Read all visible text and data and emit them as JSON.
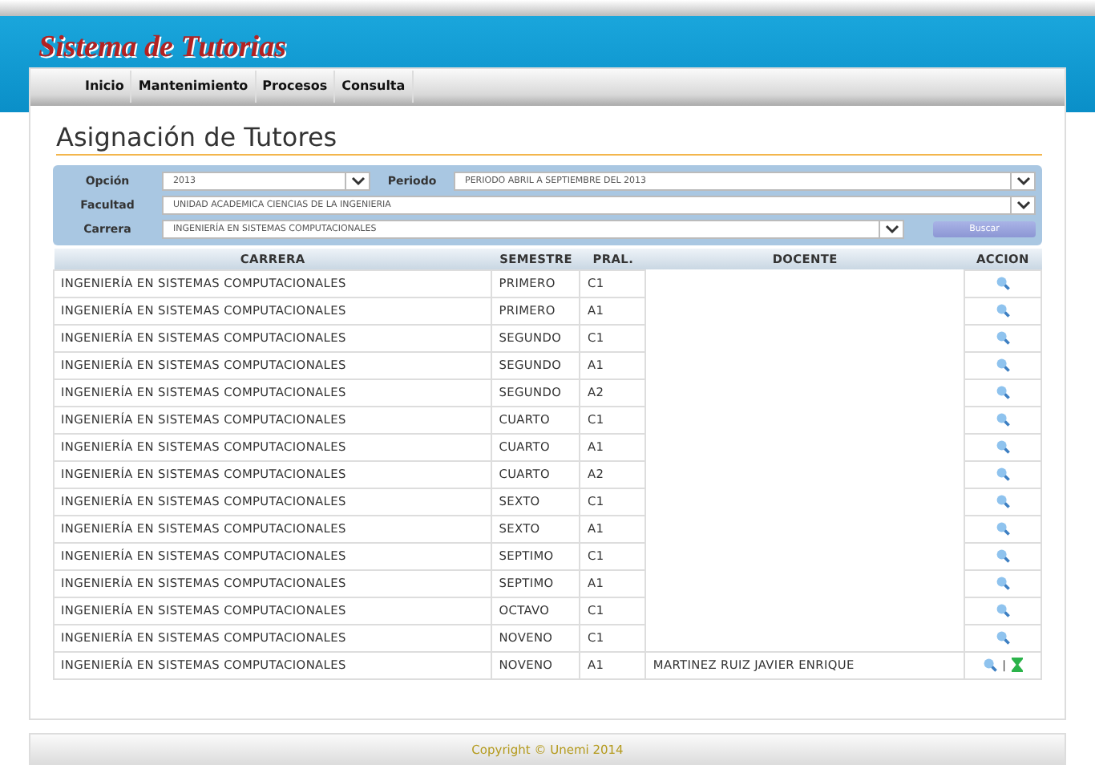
{
  "header": {
    "title": "Sistema de Tutorias"
  },
  "menu": [
    {
      "label": "Inicio"
    },
    {
      "label": "Mantenimiento"
    },
    {
      "label": "Procesos"
    },
    {
      "label": "Consulta"
    }
  ],
  "page_title": "Asignación de Tutores",
  "filters": {
    "opcion": {
      "label": "Opción",
      "value": "2013"
    },
    "periodo": {
      "label": "Periodo",
      "value": "PERIODO ABRIL A SEPTIEMBRE DEL 2013"
    },
    "facultad": {
      "label": "Facultad",
      "value": "UNIDAD ACADEMICA CIENCIAS DE LA INGENIERIA"
    },
    "carrera": {
      "label": "Carrera",
      "value": "INGENIERÍA EN SISTEMAS COMPUTACIONALES"
    },
    "search_button": "Buscar"
  },
  "table": {
    "columns": [
      "CARRERA",
      "SEMESTRE",
      "PRAL.",
      "DOCENTE",
      "ACCION"
    ],
    "rows": [
      {
        "carrera": "INGENIERÍA EN SISTEMAS COMPUTACIONALES",
        "semestre": "PRIMERO",
        "pral": "C1",
        "actions": [
          {
            "kind": "view"
          }
        ]
      },
      {
        "carrera": "INGENIERÍA EN SISTEMAS COMPUTACIONALES",
        "semestre": "PRIMERO",
        "pral": "A1",
        "actions": [
          {
            "kind": "view"
          }
        ]
      },
      {
        "carrera": "INGENIERÍA EN SISTEMAS COMPUTACIONALES",
        "semestre": "SEGUNDO",
        "pral": "C1",
        "actions": [
          {
            "kind": "view"
          }
        ]
      },
      {
        "carrera": "INGENIERÍA EN SISTEMAS COMPUTACIONALES",
        "semestre": "SEGUNDO",
        "pral": "A1",
        "actions": [
          {
            "kind": "view"
          }
        ]
      },
      {
        "carrera": "INGENIERÍA EN SISTEMAS COMPUTACIONALES",
        "semestre": "SEGUNDO",
        "pral": "A2",
        "actions": [
          {
            "kind": "view"
          }
        ]
      },
      {
        "carrera": "INGENIERÍA EN SISTEMAS COMPUTACIONALES",
        "semestre": "CUARTO",
        "pral": "C1",
        "actions": [
          {
            "kind": "view"
          }
        ]
      },
      {
        "carrera": "INGENIERÍA EN SISTEMAS COMPUTACIONALES",
        "semestre": "CUARTO",
        "pral": "A1",
        "actions": [
          {
            "kind": "view"
          }
        ]
      },
      {
        "carrera": "INGENIERÍA EN SISTEMAS COMPUTACIONALES",
        "semestre": "CUARTO",
        "pral": "A2",
        "actions": [
          {
            "kind": "view"
          }
        ]
      },
      {
        "carrera": "INGENIERÍA EN SISTEMAS COMPUTACIONALES",
        "semestre": "SEXTO",
        "pral": "C1",
        "actions": [
          {
            "kind": "view"
          }
        ]
      },
      {
        "carrera": "INGENIERÍA EN SISTEMAS COMPUTACIONALES",
        "semestre": "SEXTO",
        "pral": "A1",
        "actions": [
          {
            "kind": "view"
          }
        ]
      },
      {
        "carrera": "INGENIERÍA EN SISTEMAS COMPUTACIONALES",
        "semestre": "SEPTIMO",
        "pral": "C1",
        "actions": [
          {
            "kind": "view"
          }
        ]
      },
      {
        "carrera": "INGENIERÍA EN SISTEMAS COMPUTACIONALES",
        "semestre": "SEPTIMO",
        "pral": "A1",
        "actions": [
          {
            "kind": "view"
          }
        ]
      },
      {
        "carrera": "INGENIERÍA EN SISTEMAS COMPUTACIONALES",
        "semestre": "OCTAVO",
        "pral": "C1",
        "actions": [
          {
            "kind": "view"
          }
        ]
      },
      {
        "carrera": "INGENIERÍA EN SISTEMAS COMPUTACIONALES",
        "semestre": "NOVENO",
        "pral": "C1",
        "actions": [
          {
            "kind": "view"
          }
        ]
      },
      {
        "carrera": "INGENIERÍA EN SISTEMAS COMPUTACIONALES",
        "semestre": "NOVENO",
        "pral": "A1",
        "docente": "MARTINEZ RUIZ JAVIER ENRIQUE",
        "actions": [
          {
            "kind": "view"
          },
          {
            "kind": "separator",
            "text": "|"
          },
          {
            "kind": "hourglass"
          }
        ]
      }
    ]
  },
  "footer": "Copyright © Unemi 2014"
}
